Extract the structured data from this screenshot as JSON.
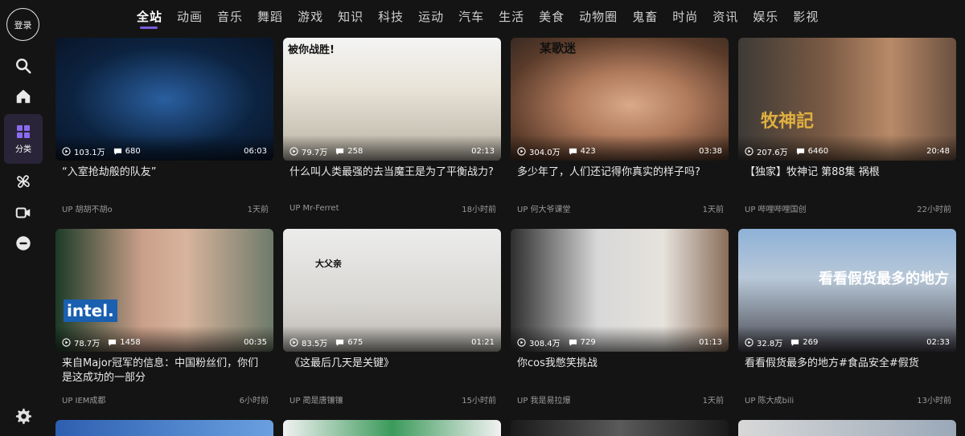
{
  "sidebar": {
    "login_label": "登录",
    "active_label": "分类"
  },
  "tabs": [
    "全站",
    "动画",
    "音乐",
    "舞蹈",
    "游戏",
    "知识",
    "科技",
    "运动",
    "汽车",
    "生活",
    "美食",
    "动物圈",
    "鬼畜",
    "时尚",
    "资讯",
    "娱乐",
    "影视"
  ],
  "videos": [
    {
      "title": "“入室抢劫般的队友”",
      "views": "103.1万",
      "comments": "680",
      "duration": "06:03",
      "up": "UP 胡胡不胡o",
      "time": "1天前",
      "caption": ""
    },
    {
      "title": "什么叫人类最强的去当魔王是为了平衡战力?",
      "views": "79.7万",
      "comments": "258",
      "duration": "02:13",
      "up": "UP Mr-Ferret",
      "time": "18小时前",
      "caption": "被你战胜!"
    },
    {
      "title": "多少年了，人们还记得你真实的样子吗?",
      "views": "304.0万",
      "comments": "423",
      "duration": "03:38",
      "up": "UP 何大爷课堂",
      "time": "1天前",
      "caption": "某歌迷"
    },
    {
      "title": "【独家】牧神记 第88集 祸根",
      "views": "207.6万",
      "comments": "6460",
      "duration": "20:48",
      "up": "UP 哔哩哔哩国创",
      "time": "22小时前",
      "caption": "牧神記"
    },
    {
      "title": "来自Major冠军的信息：中国粉丝们，你们是这成功的一部分",
      "views": "78.7万",
      "comments": "1458",
      "duration": "00:35",
      "up": "UP IEM成都",
      "time": "6小时前",
      "caption": "intel."
    },
    {
      "title": "《这最后几天是关键》",
      "views": "83.5万",
      "comments": "675",
      "duration": "01:21",
      "up": "UP 蔺是唐镶镶",
      "time": "15小时前",
      "caption": "大父亲"
    },
    {
      "title": "你cos我憋笑挑战",
      "views": "308.4万",
      "comments": "729",
      "duration": "01:13",
      "up": "UP 我是易拉爆",
      "time": "1天前",
      "caption": ""
    },
    {
      "title": "看看假货最多的地方#食品安全#假货",
      "views": "32.8万",
      "comments": "269",
      "duration": "02:33",
      "up": "UP 陈大成bili",
      "time": "13小时前",
      "caption": "看看假货最多的地方"
    }
  ],
  "colors": {
    "background": "#141414",
    "accent": "#7b5cd6",
    "active_nav_bg": "#2a2438"
  }
}
